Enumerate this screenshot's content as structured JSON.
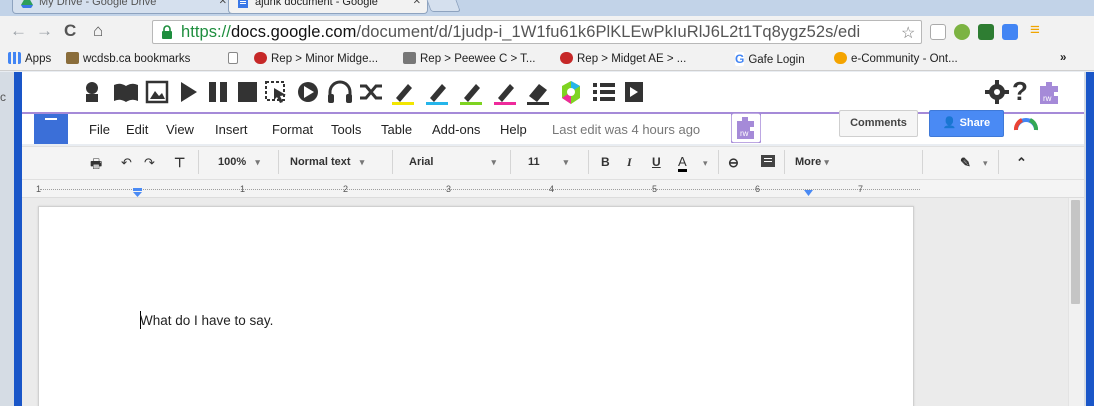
{
  "tabs": [
    {
      "label": "My Drive - Google Drive",
      "active": false
    },
    {
      "label": "ajunk document - Google",
      "active": true
    }
  ],
  "address": {
    "protocol": "https://",
    "host": "docs.google.com",
    "path": "/document/d/1judp-i_1W1fu61k6PlKLEwPkIuRlJ6L2t1Tq8ygz52s/edi"
  },
  "bookmarks": [
    {
      "label": "Apps",
      "icon": "apps-grid-icon",
      "color": "#4285f4"
    },
    {
      "label": "wcdsb.ca bookmarks",
      "icon": "folder-icon",
      "color": "#8a6d3b"
    },
    {
      "label": "",
      "icon": "page-icon",
      "color": "#888888"
    },
    {
      "label": "Rep > Minor Midge...",
      "icon": "rep-logo-icon",
      "color": "#c62828"
    },
    {
      "label": "Rep > Peewee C > T...",
      "icon": "team-logo-icon",
      "color": "#555555"
    },
    {
      "label": "Rep > Midget AE > ...",
      "icon": "rep-logo-icon",
      "color": "#c62828"
    },
    {
      "label": "Gafe Login",
      "icon": "google-g-icon",
      "color": "#4285f4"
    },
    {
      "label": "e-Community - Ont...",
      "icon": "ecommunity-icon",
      "color": "#f4a400"
    }
  ],
  "bookmarks_more": "»",
  "left_edge_letter": "c",
  "menu": [
    "File",
    "Edit",
    "View",
    "Insert",
    "Format",
    "Tools",
    "Table",
    "Add-ons",
    "Help"
  ],
  "last_edit": "Last edit was 4 hours ago",
  "rw_badge": "rw",
  "comments_label": "Comments",
  "share_label": "Share",
  "toolbar": {
    "zoom": "100%",
    "style": "Normal text",
    "font": "Arial",
    "size": "11",
    "bold": "B",
    "italic": "I",
    "underline": "U",
    "text_color": "A",
    "more": "More"
  },
  "ruler_numbers": [
    "1",
    "1",
    "2",
    "3",
    "4",
    "5",
    "6",
    "7"
  ],
  "document_text": "What do I have to say.",
  "colors": {
    "accent_blue": "#4a8af4",
    "rw_purple": "#a58ad8",
    "chrome_bar": "#f2f2f2",
    "tab_strip": "#c2d3e8"
  }
}
